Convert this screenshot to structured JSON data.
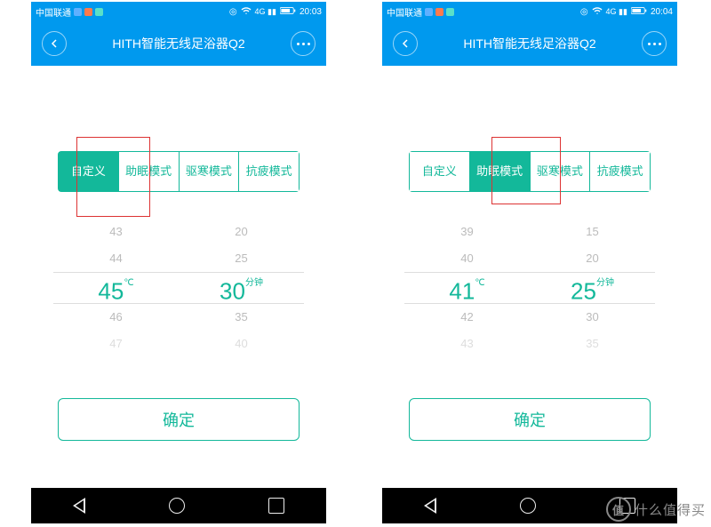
{
  "statusbar": {
    "carrier": "中国联通",
    "sim_colors": [
      "#5fb0ff",
      "#ff7a4d",
      "#5ae0c8"
    ],
    "time_left": "20:03",
    "time_right": "20:04"
  },
  "topbar": {
    "title": "HITH智能无线足浴器Q2"
  },
  "tabs": [
    "自定义",
    "助眠模式",
    "驱寒模式",
    "抗疲模式"
  ],
  "left": {
    "active_tab": 0,
    "temp": {
      "above2": "43",
      "above1": "44",
      "sel": "45",
      "unit": "℃",
      "below1": "46",
      "below2": "47"
    },
    "time": {
      "above2": "20",
      "above1": "25",
      "sel": "30",
      "unit": "分钟",
      "below1": "35",
      "below2": "40"
    }
  },
  "right": {
    "active_tab": 1,
    "temp": {
      "above2": "39",
      "above1": "40",
      "sel": "41",
      "unit": "℃",
      "below1": "42",
      "below2": "43"
    },
    "time": {
      "above2": "15",
      "above1": "20",
      "sel": "25",
      "unit": "分钟",
      "below1": "30",
      "below2": "35"
    }
  },
  "confirm_label": "确定",
  "watermark": "什么值得买"
}
